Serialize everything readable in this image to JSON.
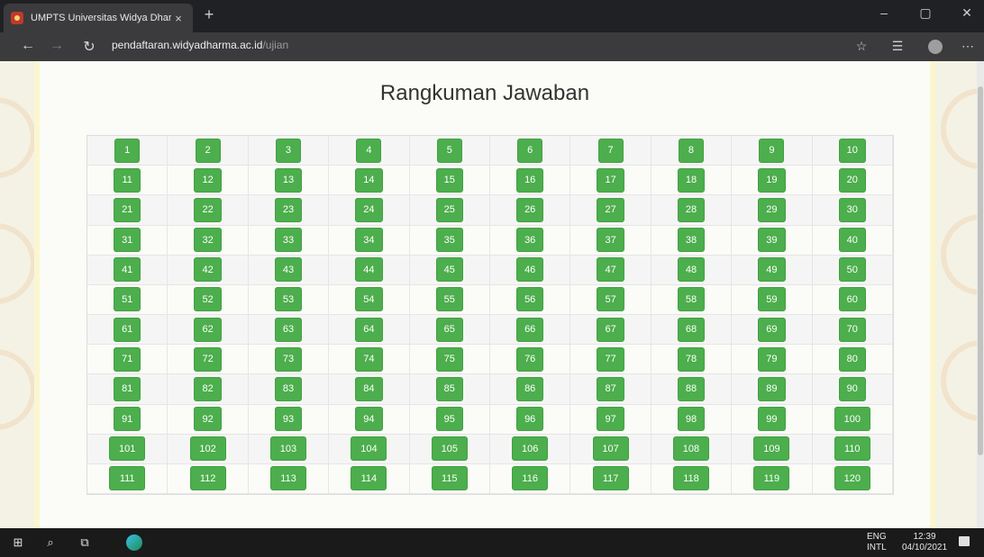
{
  "browser": {
    "tab_title": "UMPTS Universitas Widya Dharm",
    "tab_close": "×",
    "new_tab": "+",
    "address_domain": "pendaftaran.widyadharma.ac.id",
    "address_path": "/ujian",
    "window_controls": [
      "–",
      "▢",
      "✕"
    ]
  },
  "page": {
    "title": "Rangkuman Jawaban",
    "button_color": "#4cae4c",
    "questions": [
      "1",
      "2",
      "3",
      "4",
      "5",
      "6",
      "7",
      "8",
      "9",
      "10",
      "11",
      "12",
      "13",
      "14",
      "15",
      "16",
      "17",
      "18",
      "19",
      "20",
      "21",
      "22",
      "23",
      "24",
      "25",
      "26",
      "27",
      "28",
      "29",
      "30",
      "31",
      "32",
      "33",
      "34",
      "35",
      "36",
      "37",
      "38",
      "39",
      "40",
      "41",
      "42",
      "43",
      "44",
      "45",
      "46",
      "47",
      "48",
      "49",
      "50",
      "51",
      "52",
      "53",
      "54",
      "55",
      "56",
      "57",
      "58",
      "59",
      "60",
      "61",
      "62",
      "63",
      "64",
      "65",
      "66",
      "67",
      "68",
      "69",
      "70",
      "71",
      "72",
      "73",
      "74",
      "75",
      "76",
      "77",
      "78",
      "79",
      "80",
      "81",
      "82",
      "83",
      "84",
      "85",
      "86",
      "87",
      "88",
      "89",
      "90",
      "91",
      "92",
      "93",
      "94",
      "95",
      "96",
      "97",
      "98",
      "99",
      "100",
      "101",
      "102",
      "103",
      "104",
      "105",
      "106",
      "107",
      "108",
      "109",
      "110",
      "111",
      "112",
      "113",
      "114",
      "115",
      "116",
      "117",
      "118",
      "119",
      "120"
    ]
  },
  "taskbar": {
    "lang_line1": "ENG",
    "lang_line2": "INTL",
    "time": "12:39",
    "date": "04/10/2021"
  }
}
